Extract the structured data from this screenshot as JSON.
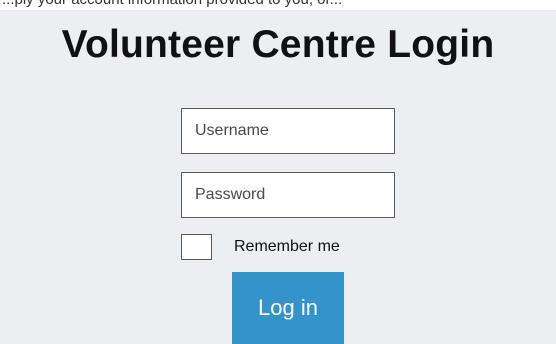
{
  "page": {
    "top_text": "...ply your account information provided to you, or..."
  },
  "login": {
    "title": "Volunteer Centre Login",
    "username_placeholder": "Username",
    "password_placeholder": "Password",
    "remember_label": "Remember me",
    "remember_checked": false,
    "submit_label": "Log in"
  },
  "colors": {
    "panel_background": "#ebeff2",
    "button_background": "#3593cc",
    "button_text": "#ffffff",
    "field_border": "#5a5a5a"
  }
}
